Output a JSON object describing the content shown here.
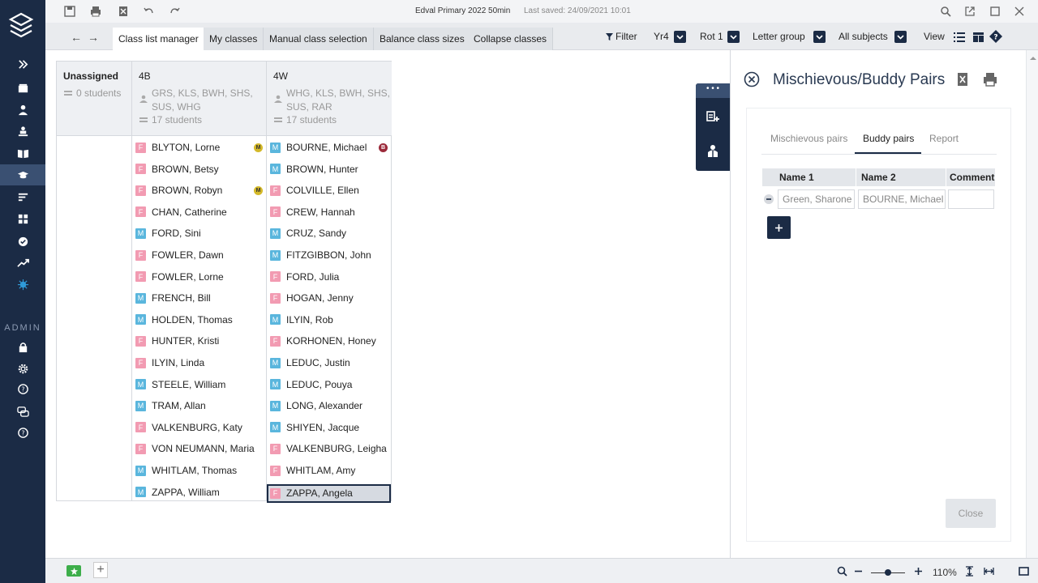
{
  "window": {
    "title": "Edval Primary 2022 50min",
    "last_saved": "Last saved: 24/09/2021 10:01"
  },
  "sidebar": {
    "admin_label": "ADMIN"
  },
  "tabs": [
    {
      "label": "Class list manager",
      "active": true
    },
    {
      "label": "My classes"
    },
    {
      "label": "Manual class selection"
    },
    {
      "label": "Balance class sizes"
    },
    {
      "label": "Collapse classes"
    }
  ],
  "filters": {
    "filter_label": "Filter",
    "year": "Yr4",
    "rotation": "Rot 1",
    "group_by": "Letter group",
    "subjects": "All subjects",
    "view_label": "View"
  },
  "columns": {
    "unassigned": {
      "name": "Unassigned",
      "count": "0 students"
    },
    "c4b": {
      "name": "4B",
      "teachers": "GRS, KLS, BWH, SHS, SUS, WHG",
      "count": "17 students",
      "students": [
        {
          "g": "F",
          "name": "BLYTON, Lorne",
          "flag": "M"
        },
        {
          "g": "F",
          "name": "BROWN, Betsy"
        },
        {
          "g": "F",
          "name": "BROWN, Robyn",
          "flag": "M"
        },
        {
          "g": "F",
          "name": "CHAN, Catherine"
        },
        {
          "g": "M",
          "name": "FORD, Sini"
        },
        {
          "g": "F",
          "name": "FOWLER, Dawn"
        },
        {
          "g": "F",
          "name": "FOWLER, Lorne"
        },
        {
          "g": "M",
          "name": "FRENCH, Bill"
        },
        {
          "g": "M",
          "name": "HOLDEN, Thomas"
        },
        {
          "g": "F",
          "name": "HUNTER, Kristi"
        },
        {
          "g": "F",
          "name": "ILYIN, Linda"
        },
        {
          "g": "M",
          "name": "STEELE, William"
        },
        {
          "g": "M",
          "name": "TRAM, Allan"
        },
        {
          "g": "F",
          "name": "VALKENBURG, Katy"
        },
        {
          "g": "F",
          "name": "VON NEUMANN, Maria"
        },
        {
          "g": "M",
          "name": "WHITLAM, Thomas"
        },
        {
          "g": "M",
          "name": "ZAPPA, William"
        }
      ]
    },
    "c4w": {
      "name": "4W",
      "teachers": "WHG, KLS, BWH, SHS, SUS, RAR",
      "count": "17 students",
      "students": [
        {
          "g": "M",
          "name": "BOURNE, Michael",
          "flag": "B"
        },
        {
          "g": "M",
          "name": "BROWN, Hunter"
        },
        {
          "g": "F",
          "name": "COLVILLE, Ellen"
        },
        {
          "g": "F",
          "name": "CREW, Hannah"
        },
        {
          "g": "M",
          "name": "CRUZ, Sandy"
        },
        {
          "g": "M",
          "name": "FITZGIBBON, John"
        },
        {
          "g": "F",
          "name": "FORD, Julia"
        },
        {
          "g": "F",
          "name": "HOGAN, Jenny"
        },
        {
          "g": "M",
          "name": "ILYIN, Rob"
        },
        {
          "g": "F",
          "name": "KORHONEN, Honey"
        },
        {
          "g": "M",
          "name": "LEDUC, Justin"
        },
        {
          "g": "M",
          "name": "LEDUC, Pouya"
        },
        {
          "g": "M",
          "name": "LONG, Alexander"
        },
        {
          "g": "M",
          "name": "SHIYEN, Jacque"
        },
        {
          "g": "F",
          "name": "VALKENBURG, Leigha"
        },
        {
          "g": "F",
          "name": "WHITLAM, Amy"
        },
        {
          "g": "F",
          "name": "ZAPPA, Angela",
          "selected": true
        }
      ]
    }
  },
  "float_panel": {
    "handle": "• • •"
  },
  "panel": {
    "title": "Mischievous/Buddy Pairs",
    "subtabs": [
      "Mischievous pairs",
      "Buddy pairs",
      "Report"
    ],
    "active_subtab": "Buddy pairs",
    "table_headers": [
      "Name 1",
      "Name 2",
      "Comment"
    ],
    "rows": [
      {
        "name1": "Green, Sharone",
        "name2": "BOURNE, Michael",
        "comment": ""
      }
    ],
    "close_label": "Close"
  },
  "zoom": {
    "value": "110%",
    "level": 0.5
  },
  "colors": {
    "navy": "#1b2b45",
    "female": "#f29bb2",
    "male": "#5ab6dd",
    "flag_m": "#d4b92a",
    "flag_b": "#9b2a3a"
  }
}
